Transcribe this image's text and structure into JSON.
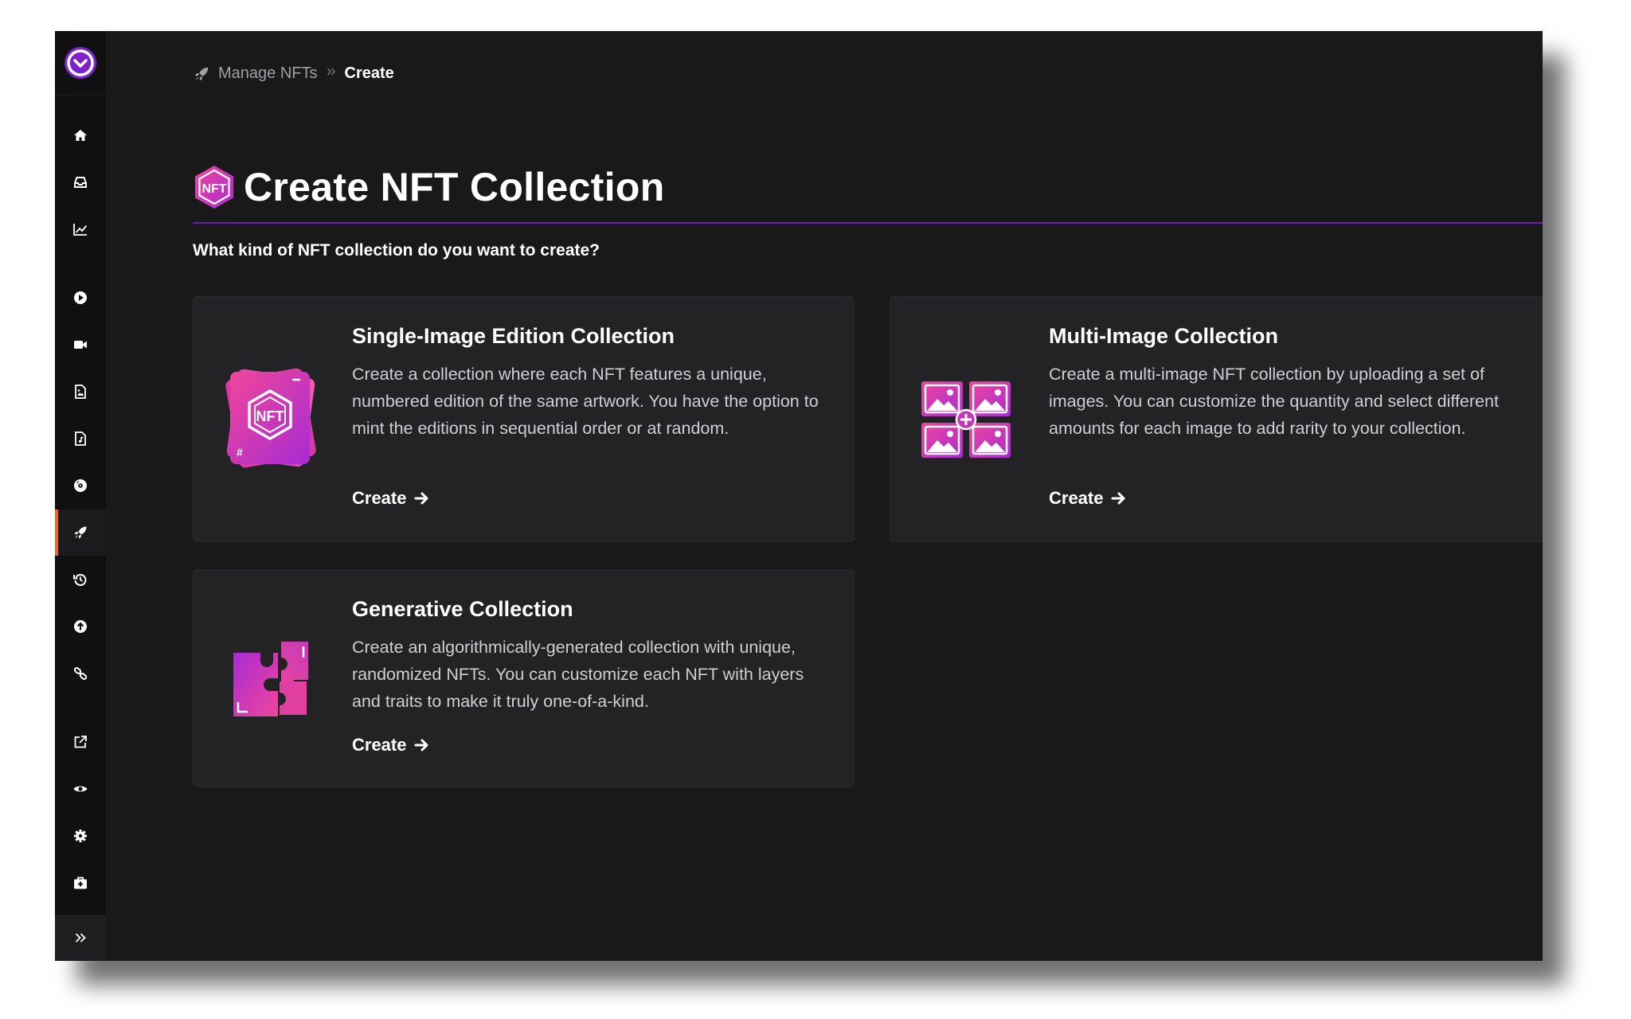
{
  "colors": {
    "accent": "#7e22ce",
    "active_indicator": "#ea6a1e",
    "background": "#19191a",
    "card": "#232325",
    "sidebar": "#101011",
    "icon_gradient_start": "#f0469a",
    "icon_gradient_end": "#a72bd3"
  },
  "sidebar": {
    "logo_icon": "chevron-down-circle-icon",
    "items": [
      {
        "icon": "home-icon"
      },
      {
        "icon": "inbox-icon"
      },
      {
        "icon": "chart-line-icon"
      },
      {
        "icon": "play-circle-icon"
      },
      {
        "icon": "video-camera-icon"
      },
      {
        "icon": "document-image-icon"
      },
      {
        "icon": "document-music-icon"
      },
      {
        "icon": "disc-icon"
      },
      {
        "icon": "rocket-icon",
        "active": true
      },
      {
        "icon": "history-icon"
      },
      {
        "icon": "upload-circle-icon"
      },
      {
        "icon": "link-icon"
      },
      {
        "icon": "external-link-icon"
      },
      {
        "icon": "eye-icon"
      },
      {
        "icon": "gear-icon"
      },
      {
        "icon": "first-aid-kit-icon"
      }
    ],
    "expand_icon": "double-chevron-right-icon"
  },
  "breadcrumb": {
    "icon": "rocket-icon",
    "parent": "Manage NFTs",
    "current": "Create"
  },
  "page": {
    "title": "Create NFT Collection",
    "title_icon": "nft-hexagon-icon",
    "question": "What kind of NFT collection do you want to create?"
  },
  "cards": [
    {
      "title": "Single-Image Edition Collection",
      "description": "Create a collection where each NFT features a unique, numbered edition of the same artwork. You have the option to mint the editions in sequential order or at random.",
      "link": "Create",
      "icon": "nft-card-stack-icon"
    },
    {
      "title": "Multi-Image Collection",
      "description": "Create a multi-image NFT collection by uploading a set of images. You can customize the quantity and select different amounts for each image to add rarity to your collection.",
      "link": "Create",
      "icon": "image-grid-plus-icon"
    },
    {
      "title": "Generative Collection",
      "description": "Create an algorithmically-generated collection with unique, randomized NFTs. You can customize each NFT with layers and traits to make it truly one-of-a-kind.",
      "link": "Create",
      "icon": "puzzle-pieces-icon"
    }
  ]
}
